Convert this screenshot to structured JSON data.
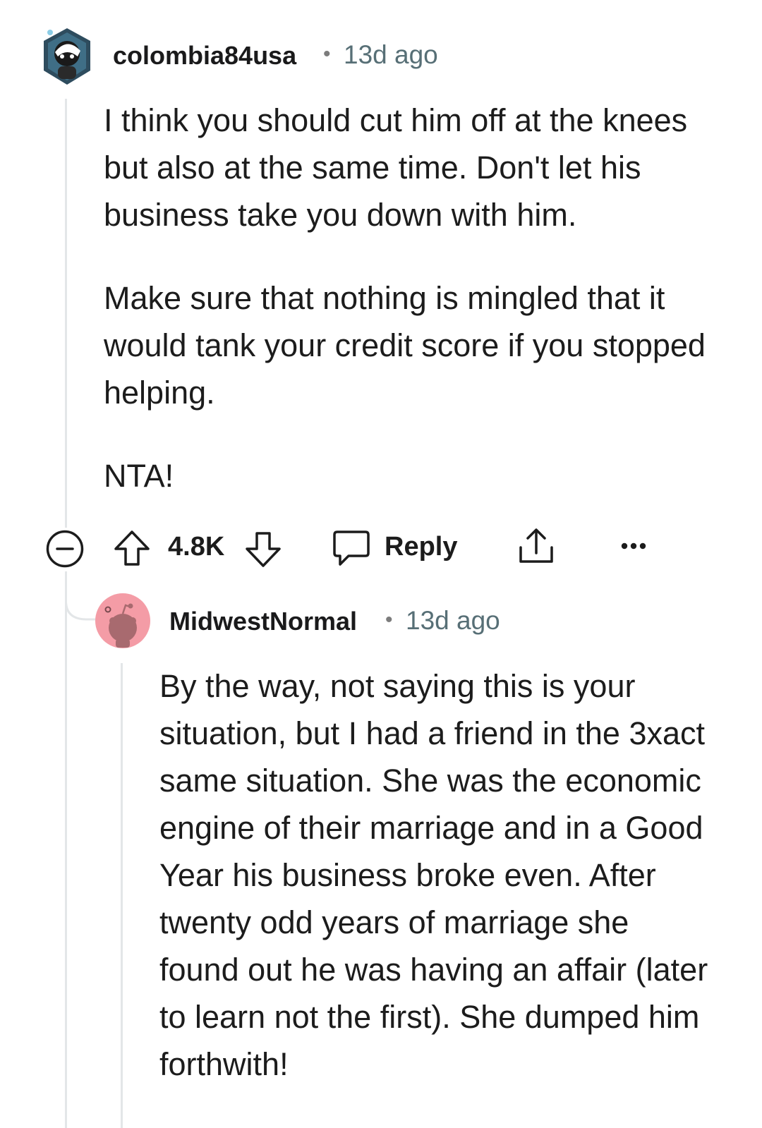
{
  "comment": {
    "author": "colombia84usa",
    "separator": "•",
    "age": "13d ago",
    "avatar_icon": "snoo-avatar-dark-icon",
    "paragraphs": [
      "I think you should cut him off at the knees but also at the same time. Don't let his business take you down with him.",
      "Make sure that nothing is mingled that it would tank your credit score if you stopped helping.",
      "NTA!"
    ],
    "actions": {
      "collapse_icon": "collapse-minus-icon",
      "upvote_icon": "upvote-arrow-icon",
      "score": "4.8K",
      "downvote_icon": "downvote-arrow-icon",
      "reply_icon": "speech-bubble-icon",
      "reply_label": "Reply",
      "share_icon": "share-icon",
      "more_icon": "more-options-icon"
    }
  },
  "reply": {
    "author": "MidwestNormal",
    "separator": "•",
    "age": "13d ago",
    "avatar_icon": "snoo-avatar-pink-icon",
    "avatar_color": "#f49ca6",
    "text": "By the way, not saying this is your situation, but I had a friend in the 3xact same situation. She was the economic engine of their marriage and in a Good Year his business broke even. After twenty odd years of marriage she found out he was having an affair (later to learn not the first). She dumped him forthwith!"
  },
  "colors": {
    "thread_line": "#e3e6e8",
    "meta_text": "#576f76",
    "body_text": "#1c1c1c"
  }
}
